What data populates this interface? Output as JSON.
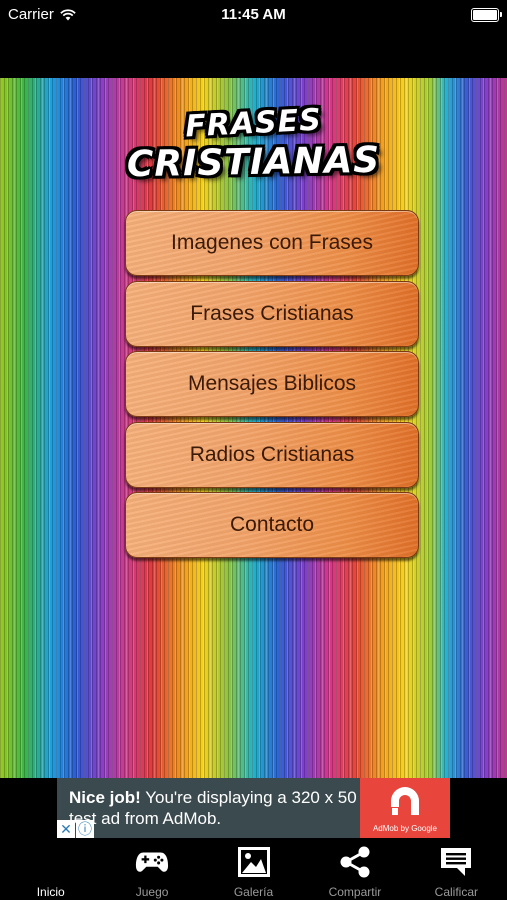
{
  "status_bar": {
    "carrier": "Carrier",
    "time": "11:45 AM"
  },
  "logo": {
    "line1": "FRASES",
    "line2": "CRISTIANAS"
  },
  "menu": [
    {
      "label": "Imagenes con Frases"
    },
    {
      "label": "Frases Cristianas"
    },
    {
      "label": "Mensajes Biblicos"
    },
    {
      "label": "Radios Cristianas"
    },
    {
      "label": "Contacto"
    }
  ],
  "ad": {
    "headline": "Nice job!",
    "body": " You're displaying a 320 x 50 test ad from AdMob.",
    "brand": "AdMob by Google",
    "close": "✕",
    "info": "ⓘ"
  },
  "tabs": [
    {
      "label": "Inicio",
      "icon": "home-icon",
      "active": true
    },
    {
      "label": "Juego",
      "icon": "gamepad-icon",
      "active": false
    },
    {
      "label": "Galería",
      "icon": "image-icon",
      "active": false
    },
    {
      "label": "Compartir",
      "icon": "share-icon",
      "active": false
    },
    {
      "label": "Calificar",
      "icon": "comment-icon",
      "active": false
    }
  ],
  "colors": {
    "button": "#f3a46a",
    "button_text": "#3b1a08",
    "ad_bg": "#3b4a4f",
    "ad_brand": "#e8453c"
  }
}
